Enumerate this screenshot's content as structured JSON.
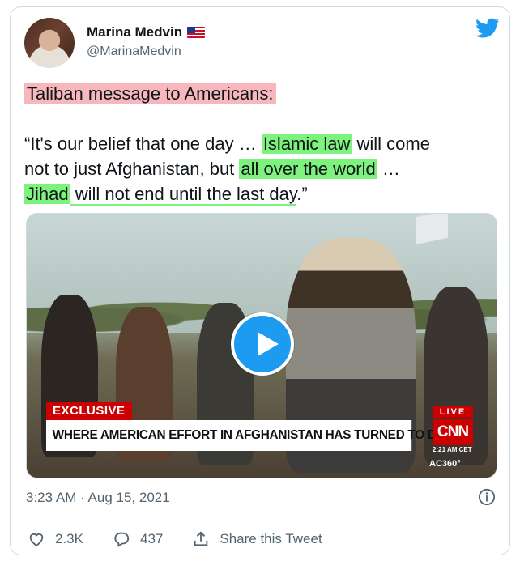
{
  "author": {
    "display_name": "Marina Medvin",
    "handle": "@MarinaMedvin",
    "flag_icon": "us-flag-icon",
    "platform_icon": "twitter-bird-icon"
  },
  "tweet": {
    "headline": "Taliban message to Americans:",
    "quote": {
      "line1_a": "“It's our belief that one day … ",
      "line1_b": "Islamic law",
      "line1_c": " will come",
      "line2_a": "not to just Afghanistan, but ",
      "line2_b": "all over the world",
      "line2_c": " …",
      "line3_a": "Jihad",
      "line3_b": " will not end until the last day",
      "line3_c": ".”"
    },
    "highlight_colors": {
      "red": "#f7b8bd",
      "green": "#7df27d"
    }
  },
  "media": {
    "play_icon": "play-icon",
    "exclusive_label": "EXCLUSIVE",
    "chyron": "WHERE AMERICAN EFFORT IN AFGHANISTAN HAS TURNED TO DUST",
    "live_label": "LIVE",
    "network_logo": "CNN",
    "time_label": "2:21 AM CET",
    "show_label": "AC360°"
  },
  "meta": {
    "timestamp": "3:23 AM · Aug 15, 2021"
  },
  "actions": {
    "likes": "2.3K",
    "replies": "437",
    "share_label": "Share this Tweet"
  },
  "colors": {
    "accent": "#1d9bf0",
    "text": "#0f1419",
    "muted": "#536471",
    "border": "#cfd9de"
  }
}
